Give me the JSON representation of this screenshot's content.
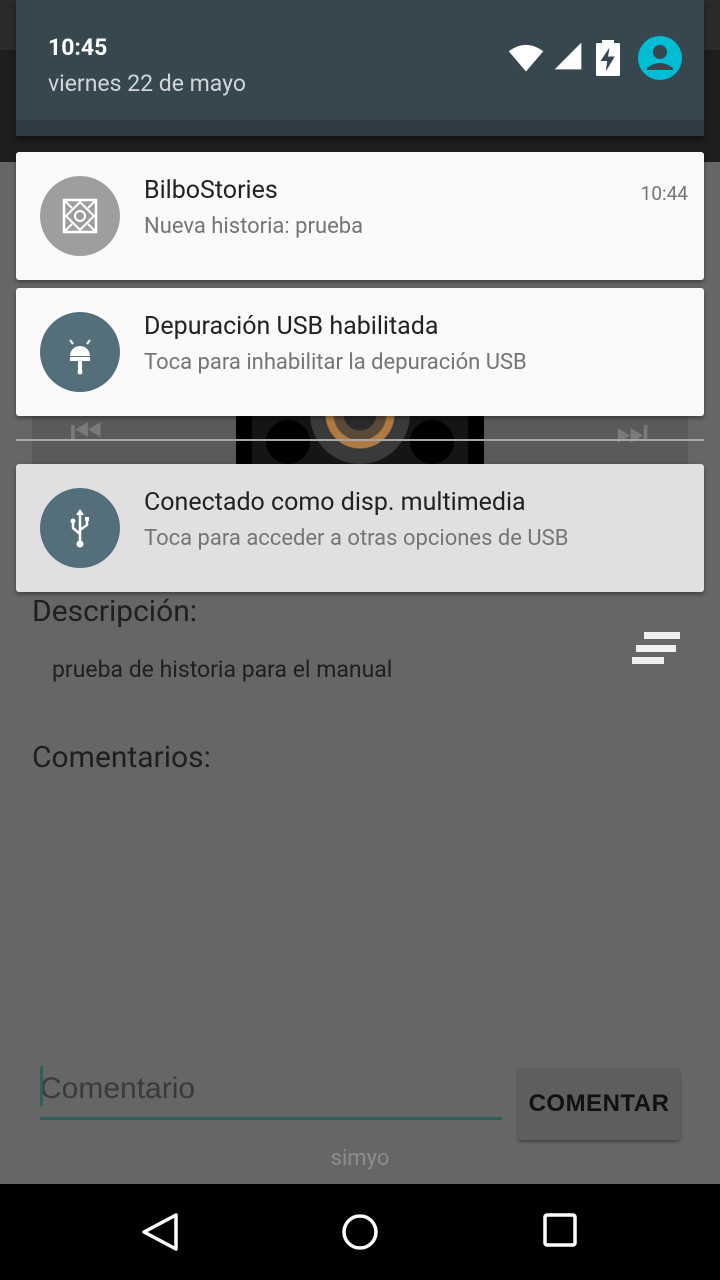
{
  "status": {
    "time": "10:45",
    "date": "viernes 22 de mayo"
  },
  "notifications": [
    {
      "app": "BilboStories",
      "text": "Nueva historia: prueba",
      "time": "10:44",
      "icon": "bilbostories-logo-icon",
      "color": "#9e9e9e"
    },
    {
      "app": "Depuración USB habilitada",
      "text": "Toca para inhabilitar la depuración USB",
      "icon": "android-debug-icon",
      "color": "#546e7a"
    },
    {
      "app": "Conectado como disp. multimedia",
      "text": "Toca para acceder a otras opciones de USB",
      "icon": "usb-icon",
      "color": "#546e7a"
    }
  ],
  "app": {
    "description_label": "Descripción:",
    "description_text": "prueba de historia para el manual",
    "comments_label": "Comentarios:",
    "comment_placeholder": "Comentario",
    "comment_button": "COMENTAR",
    "carrier": "simyo"
  },
  "icons": {
    "wifi": "wifi-icon",
    "signal": "signal-icon",
    "battery": "battery-charging-icon",
    "user": "user-avatar-icon",
    "menu": "text-lines-icon",
    "back": "back-icon",
    "home": "home-icon",
    "recents": "recents-icon"
  },
  "colors": {
    "shade_header": "#37474f",
    "accent": "#00bcd4",
    "icon_blue_grey": "#546e7a"
  }
}
